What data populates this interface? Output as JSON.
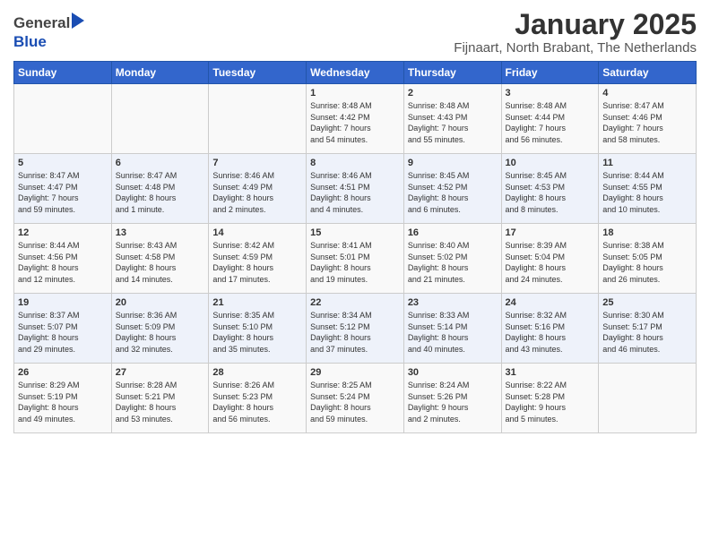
{
  "header": {
    "logo_general": "General",
    "logo_blue": "Blue",
    "title": "January 2025",
    "location": "Fijnaart, North Brabant, The Netherlands"
  },
  "days_of_week": [
    "Sunday",
    "Monday",
    "Tuesday",
    "Wednesday",
    "Thursday",
    "Friday",
    "Saturday"
  ],
  "weeks": [
    [
      {
        "day": "",
        "content": ""
      },
      {
        "day": "",
        "content": ""
      },
      {
        "day": "",
        "content": ""
      },
      {
        "day": "1",
        "content": "Sunrise: 8:48 AM\nSunset: 4:42 PM\nDaylight: 7 hours\nand 54 minutes."
      },
      {
        "day": "2",
        "content": "Sunrise: 8:48 AM\nSunset: 4:43 PM\nDaylight: 7 hours\nand 55 minutes."
      },
      {
        "day": "3",
        "content": "Sunrise: 8:48 AM\nSunset: 4:44 PM\nDaylight: 7 hours\nand 56 minutes."
      },
      {
        "day": "4",
        "content": "Sunrise: 8:47 AM\nSunset: 4:46 PM\nDaylight: 7 hours\nand 58 minutes."
      }
    ],
    [
      {
        "day": "5",
        "content": "Sunrise: 8:47 AM\nSunset: 4:47 PM\nDaylight: 7 hours\nand 59 minutes."
      },
      {
        "day": "6",
        "content": "Sunrise: 8:47 AM\nSunset: 4:48 PM\nDaylight: 8 hours\nand 1 minute."
      },
      {
        "day": "7",
        "content": "Sunrise: 8:46 AM\nSunset: 4:49 PM\nDaylight: 8 hours\nand 2 minutes."
      },
      {
        "day": "8",
        "content": "Sunrise: 8:46 AM\nSunset: 4:51 PM\nDaylight: 8 hours\nand 4 minutes."
      },
      {
        "day": "9",
        "content": "Sunrise: 8:45 AM\nSunset: 4:52 PM\nDaylight: 8 hours\nand 6 minutes."
      },
      {
        "day": "10",
        "content": "Sunrise: 8:45 AM\nSunset: 4:53 PM\nDaylight: 8 hours\nand 8 minutes."
      },
      {
        "day": "11",
        "content": "Sunrise: 8:44 AM\nSunset: 4:55 PM\nDaylight: 8 hours\nand 10 minutes."
      }
    ],
    [
      {
        "day": "12",
        "content": "Sunrise: 8:44 AM\nSunset: 4:56 PM\nDaylight: 8 hours\nand 12 minutes."
      },
      {
        "day": "13",
        "content": "Sunrise: 8:43 AM\nSunset: 4:58 PM\nDaylight: 8 hours\nand 14 minutes."
      },
      {
        "day": "14",
        "content": "Sunrise: 8:42 AM\nSunset: 4:59 PM\nDaylight: 8 hours\nand 17 minutes."
      },
      {
        "day": "15",
        "content": "Sunrise: 8:41 AM\nSunset: 5:01 PM\nDaylight: 8 hours\nand 19 minutes."
      },
      {
        "day": "16",
        "content": "Sunrise: 8:40 AM\nSunset: 5:02 PM\nDaylight: 8 hours\nand 21 minutes."
      },
      {
        "day": "17",
        "content": "Sunrise: 8:39 AM\nSunset: 5:04 PM\nDaylight: 8 hours\nand 24 minutes."
      },
      {
        "day": "18",
        "content": "Sunrise: 8:38 AM\nSunset: 5:05 PM\nDaylight: 8 hours\nand 26 minutes."
      }
    ],
    [
      {
        "day": "19",
        "content": "Sunrise: 8:37 AM\nSunset: 5:07 PM\nDaylight: 8 hours\nand 29 minutes."
      },
      {
        "day": "20",
        "content": "Sunrise: 8:36 AM\nSunset: 5:09 PM\nDaylight: 8 hours\nand 32 minutes."
      },
      {
        "day": "21",
        "content": "Sunrise: 8:35 AM\nSunset: 5:10 PM\nDaylight: 8 hours\nand 35 minutes."
      },
      {
        "day": "22",
        "content": "Sunrise: 8:34 AM\nSunset: 5:12 PM\nDaylight: 8 hours\nand 37 minutes."
      },
      {
        "day": "23",
        "content": "Sunrise: 8:33 AM\nSunset: 5:14 PM\nDaylight: 8 hours\nand 40 minutes."
      },
      {
        "day": "24",
        "content": "Sunrise: 8:32 AM\nSunset: 5:16 PM\nDaylight: 8 hours\nand 43 minutes."
      },
      {
        "day": "25",
        "content": "Sunrise: 8:30 AM\nSunset: 5:17 PM\nDaylight: 8 hours\nand 46 minutes."
      }
    ],
    [
      {
        "day": "26",
        "content": "Sunrise: 8:29 AM\nSunset: 5:19 PM\nDaylight: 8 hours\nand 49 minutes."
      },
      {
        "day": "27",
        "content": "Sunrise: 8:28 AM\nSunset: 5:21 PM\nDaylight: 8 hours\nand 53 minutes."
      },
      {
        "day": "28",
        "content": "Sunrise: 8:26 AM\nSunset: 5:23 PM\nDaylight: 8 hours\nand 56 minutes."
      },
      {
        "day": "29",
        "content": "Sunrise: 8:25 AM\nSunset: 5:24 PM\nDaylight: 8 hours\nand 59 minutes."
      },
      {
        "day": "30",
        "content": "Sunrise: 8:24 AM\nSunset: 5:26 PM\nDaylight: 9 hours\nand 2 minutes."
      },
      {
        "day": "31",
        "content": "Sunrise: 8:22 AM\nSunset: 5:28 PM\nDaylight: 9 hours\nand 5 minutes."
      },
      {
        "day": "",
        "content": ""
      }
    ]
  ]
}
